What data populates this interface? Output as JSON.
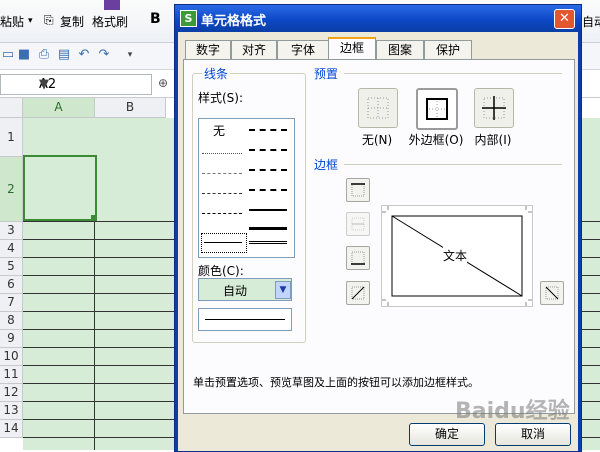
{
  "ribbon": {
    "paste_label": "粘贴",
    "copy_label": "复制",
    "format_painter_label": "格式刷",
    "bold_label": "B",
    "autofit_label": "自动"
  },
  "formula_bar": {
    "name_box_value": "A2",
    "fx_label": "fx"
  },
  "sheet": {
    "columns": [
      "A",
      "B"
    ],
    "selected_column": "A",
    "rows": [
      "1",
      "2",
      "3",
      "4",
      "5",
      "6",
      "7",
      "8",
      "9",
      "10",
      "11",
      "12",
      "13",
      "14"
    ],
    "selected_row": "2"
  },
  "dialog": {
    "icon_glyph": "S",
    "title": "单元格格式",
    "close_glyph": "✕",
    "tabs": [
      "数字",
      "对齐",
      "字体",
      "边框",
      "图案",
      "保护"
    ],
    "active_tab": "边框",
    "line_group": {
      "title": "线条",
      "style_label": "样式(S):",
      "none_label": "无",
      "color_label": "颜色(C):",
      "color_value": "自动"
    },
    "presets": {
      "title": "预置",
      "none_label": "无(N)",
      "outline_label": "外边框(O)",
      "inside_label": "内部(I)"
    },
    "border_group": {
      "title": "边框",
      "preview_text": "文本"
    },
    "hint": "单击预置选项、预览草图及上面的按钮可以添加边框样式。",
    "ok_label": "确定",
    "cancel_label": "取消"
  },
  "watermark": "Baidu经验"
}
